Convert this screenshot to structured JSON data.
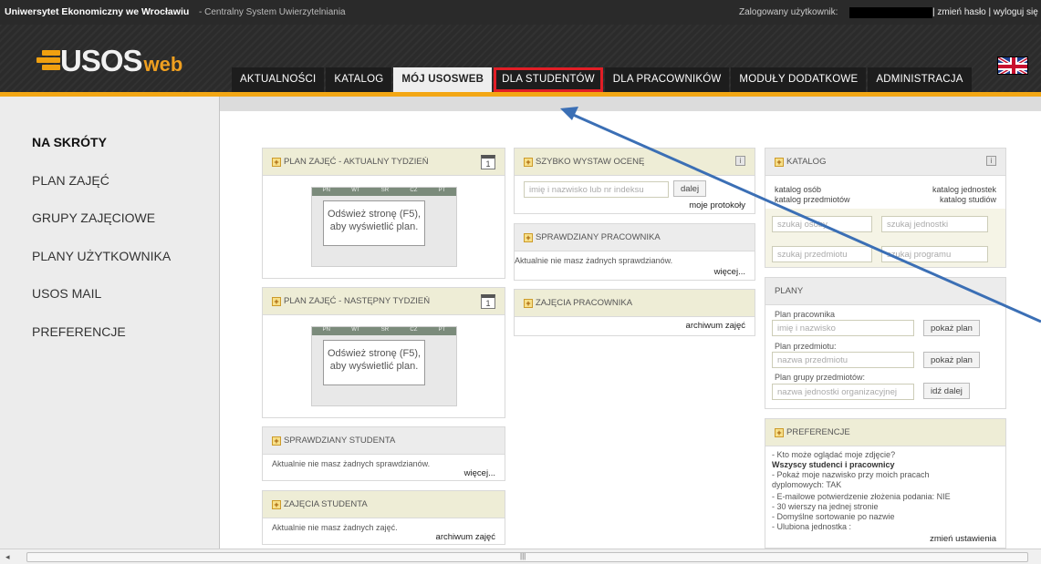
{
  "topbar": {
    "university": "Uniwersytet Ekonomiczny we Wrocławiu",
    "system": "- Centralny System Uwierzytelniania",
    "logged_in_label": "Zalogowany użytkownik:",
    "links": "| zmień hasło | wyloguj się"
  },
  "logo": {
    "usos": "USOS",
    "web": "web"
  },
  "nav": {
    "tabs": [
      "AKTUALNOŚCI",
      "KATALOG",
      "MÓJ USOSWEB",
      "DLA STUDENTÓW",
      "DLA PRACOWNIKÓW",
      "MODUŁY DODATKOWE",
      "ADMINISTRACJA"
    ],
    "active": "MÓJ USOSWEB",
    "highlighted": "DLA STUDENTÓW"
  },
  "sidebar": {
    "items": [
      "NA SKRÓTY",
      "PLAN ZAJĘĆ",
      "GRUPY ZAJĘCIOWE",
      "PLANY UŻYTKOWNIKA",
      "USOS MAIL",
      "PREFERENCJE"
    ]
  },
  "plan_current": {
    "title": "PLAN ZAJĘĆ - AKTUALNY TYDZIEŃ",
    "days": [
      "PN",
      "WT",
      "ŚR",
      "CZ",
      "PT"
    ],
    "message": "Odśwież stronę (F5), aby wyświetlić plan."
  },
  "plan_next": {
    "title": "PLAN ZAJĘĆ - NASTĘPNY TYDZIEŃ",
    "days": [
      "PN",
      "WT",
      "ŚR",
      "CZ",
      "PT"
    ],
    "message": "Odśwież stronę (F5), aby wyświetlić plan."
  },
  "student_tests": {
    "title": "SPRAWDZIANY STUDENTA",
    "text": "Aktualnie nie masz żadnych sprawdzianów.",
    "more": "więcej..."
  },
  "student_classes": {
    "title": "ZAJĘCIA STUDENTA",
    "text": "Aktualnie nie masz żadnych zajęć.",
    "archive": "archiwum zajęć"
  },
  "quick_grade": {
    "title": "SZYBKO WYSTAW OCENĘ",
    "placeholder": "imię i nazwisko lub nr indeksu",
    "button": "dalej",
    "link": "moje protokoły"
  },
  "employee_tests": {
    "title": "SPRAWDZIANY PRACOWNIKA",
    "text": "Aktualnie nie masz żadnych sprawdzianów.",
    "more": "więcej..."
  },
  "employee_classes": {
    "title": "ZAJĘCIA PRACOWNIKA",
    "archive": "archiwum zajęć"
  },
  "catalog": {
    "title": "KATALOG",
    "link_persons": "katalog osób",
    "link_units": "katalog jednostek",
    "link_subjects": "katalog przedmiotów",
    "link_studies": "katalog studiów",
    "search_person": "szukaj osoby",
    "search_unit": "szukaj jednostki",
    "search_subject": "szukaj przedmiotu",
    "search_program": "szukaj programu"
  },
  "plans": {
    "title": "PLANY",
    "employee_label": "Plan pracownika",
    "employee_placeholder": "imię i nazwisko",
    "employee_button": "pokaż plan",
    "subject_label": "Plan przedmiotu:",
    "subject_placeholder": "nazwa przedmiotu",
    "subject_button": "pokaż plan",
    "group_label": "Plan grupy przedmiotów:",
    "group_placeholder": "nazwa jednostki organizacyjnej",
    "group_button": "idź dalej"
  },
  "preferences": {
    "title": "PREFERENCJE",
    "lines": [
      "- Kto może oglądać moje zdjęcie?",
      "Wszyscy studenci i pracownicy",
      "- Pokaż moje nazwisko przy moich pracach",
      "dyplomowych: TAK",
      "- E-mailowe potwierdzenie złożenia podania: NIE",
      "- 30 wierszy na jednej stronie",
      "- Domyślne sortowanie po nazwie",
      "- Ulubiona jednostka :"
    ],
    "change": "zmień ustawienia"
  },
  "colors": {
    "accent": "#f3a714",
    "highlight": "#e21e26",
    "arrow": "#3b6fb5"
  }
}
